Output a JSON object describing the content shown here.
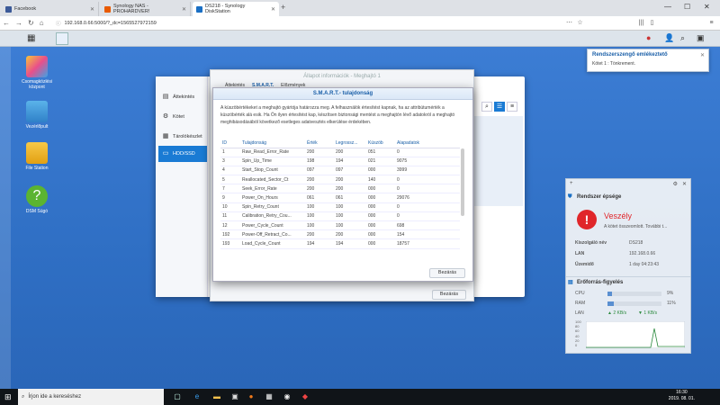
{
  "browser": {
    "tabs": [
      {
        "label": "Facebook",
        "color": "#3b5998"
      },
      {
        "label": "Synology NAS - PROHARDVER!",
        "color": "#e85a00"
      },
      {
        "label": "DS218 - Synology DiskStation",
        "color": "#1a6fc4"
      }
    ],
    "url": "192.168.0.66:5000/?_dc=1565527972159",
    "min": "—",
    "max": "☐",
    "close": "✕"
  },
  "desktop_icons": [
    {
      "label": "Csomagközlési központ"
    },
    {
      "label": "Vezérlőpult"
    },
    {
      "label": "File Station"
    },
    {
      "label": "DSM Súgó"
    }
  ],
  "sidebar": {
    "items": [
      {
        "label": "Áttekintés"
      },
      {
        "label": "Kötet"
      },
      {
        "label": "Tárolókészlet"
      },
      {
        "label": "HDD/SSD"
      }
    ]
  },
  "info_window": {
    "title": "Állapot információk - Meghajtó 1",
    "tabs": [
      "Áttekintés",
      "S.M.A.R.T.",
      "Előzmények"
    ],
    "close_label": "Bezárás"
  },
  "smart": {
    "title": "S.M.A.R.T.- tulajdonság",
    "description": "A küszöbértékeket a meghajtó gyártója határozza meg. A felhasználók értesítést kapnak, ha az attribútumérték a küszöbérték alá esik. Ha Ön ilyen értesítést kap, készítsen biztonsági mentést a meghajtón lévő adatokról a meghajtó meghibásodásából következő esetleges adatvesztés elkerülése érdekében.",
    "headers": [
      "ID",
      "Tulajdonság",
      "Érték",
      "Legrossz...",
      "Küszöb",
      "Alapadatok"
    ],
    "rows": [
      [
        "1",
        "Raw_Read_Error_Rate",
        "200",
        "200",
        "051",
        "0"
      ],
      [
        "3",
        "Spin_Up_Time",
        "198",
        "194",
        "021",
        "9075"
      ],
      [
        "4",
        "Start_Stop_Count",
        "097",
        "097",
        "000",
        "3999"
      ],
      [
        "5",
        "Reallocated_Sector_Ct",
        "200",
        "200",
        "140",
        "0"
      ],
      [
        "7",
        "Seek_Error_Rate",
        "200",
        "200",
        "000",
        "0"
      ],
      [
        "9",
        "Power_On_Hours",
        "061",
        "061",
        "000",
        "29076"
      ],
      [
        "10",
        "Spin_Retry_Count",
        "100",
        "100",
        "000",
        "0"
      ],
      [
        "11",
        "Calibration_Retry_Cou...",
        "100",
        "100",
        "000",
        "0"
      ],
      [
        "12",
        "Power_Cycle_Count",
        "100",
        "100",
        "000",
        "698"
      ],
      [
        "192",
        "Power-Off_Retract_Co...",
        "200",
        "200",
        "000",
        "154"
      ],
      [
        "193",
        "Load_Cycle_Count",
        "194",
        "194",
        "000",
        "18757"
      ]
    ],
    "close_label": "Bezárás"
  },
  "notification": {
    "title": "Rendszerszengő emlékeztető",
    "body": "Kötet 1 : Tönkrement."
  },
  "health_widget": {
    "title": "Rendszer épsége",
    "status": "Veszély",
    "status_detail": "A kötet összeomlott. További t...",
    "hostname_label": "Kiszolgáló név",
    "hostname": "DS218",
    "lan_label": "LAN",
    "lan": "192.168.0.66",
    "uptime_label": "Üzemidő",
    "uptime": "1 day 04:23:43",
    "danger_color": "#e0262a"
  },
  "resource_widget": {
    "title": "Erőforrás-figyelés",
    "cpu_label": "CPU",
    "cpu_value": "9%",
    "cpu": 0.09,
    "ram_label": "RAM",
    "ram_value": "11%",
    "ram": 0.11,
    "lan_label": "LAN",
    "up": "2 KB/s",
    "down": "1 KB/s",
    "y_ticks": [
      "100",
      "80",
      "60",
      "40",
      "20",
      "0"
    ]
  },
  "taskbar": {
    "search_placeholder": "Írjon ide a kereséshez",
    "time": "16:30",
    "date": "2019. 08. 01."
  }
}
